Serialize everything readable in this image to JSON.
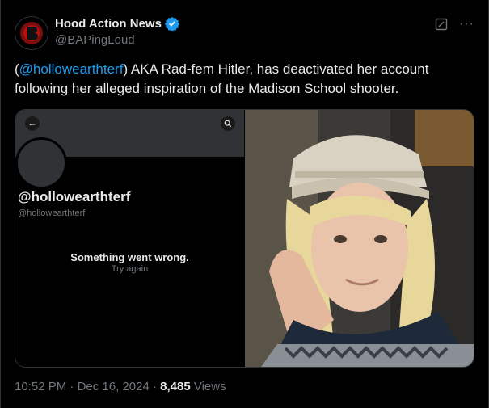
{
  "author": {
    "display_name": "Hood Action News",
    "handle": "@BAPingLoud"
  },
  "tweet": {
    "open_paren": "(",
    "mention": "@hollowearthterf",
    "text_after": ") AKA Rad-fem Hitler, has deactivated her account following her alleged inspiration of the Madison School shooter."
  },
  "media_screenshot": {
    "profile_name": "@hollowearthterf",
    "profile_handle": "@hollowearthterf",
    "error_message": "Something went wrong.",
    "retry_label": "Try again"
  },
  "meta": {
    "time": "10:52 PM",
    "separator": " · ",
    "date": "Dec 16, 2024",
    "separator2": " · ",
    "views_count": "8,485",
    "views_label": " Views"
  },
  "colors": {
    "background": "#000000",
    "text": "#e7e9ea",
    "muted": "#71767b",
    "link": "#1d9bf0",
    "border": "#2f3336"
  }
}
